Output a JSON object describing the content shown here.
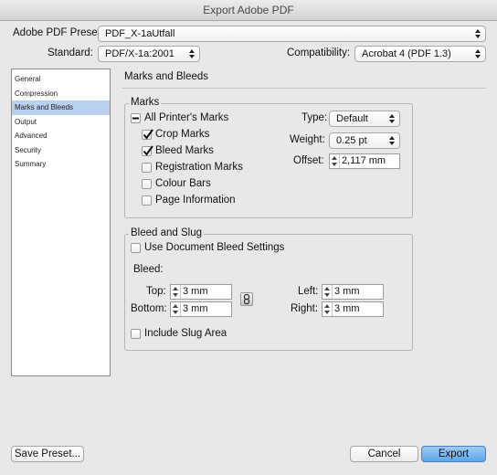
{
  "window": {
    "title": "Export Adobe PDF"
  },
  "header": {
    "preset_label": "Adobe PDF Preset:",
    "preset_value": "PDF_X-1aUtfall",
    "standard_label": "Standard:",
    "standard_value": "PDF/X-1a:2001",
    "compatibility_label": "Compatibility:",
    "compatibility_value": "Acrobat 4 (PDF 1.3)"
  },
  "sidebar": {
    "items": [
      {
        "label": "General"
      },
      {
        "label": "Compression"
      },
      {
        "label": "Marks and Bleeds"
      },
      {
        "label": "Output"
      },
      {
        "label": "Advanced"
      },
      {
        "label": "Security"
      },
      {
        "label": "Summary"
      }
    ],
    "selected": "Marks and Bleeds"
  },
  "main": {
    "section_title": "Marks and Bleeds",
    "marks": {
      "legend": "Marks",
      "all_printers_marks": {
        "label": "All Printer's Marks",
        "state": "mixed"
      },
      "crop_marks": {
        "label": "Crop Marks",
        "checked": true
      },
      "bleed_marks": {
        "label": "Bleed Marks",
        "checked": true
      },
      "registration_marks": {
        "label": "Registration Marks",
        "checked": false
      },
      "colour_bars": {
        "label": "Colour Bars",
        "checked": false
      },
      "page_information": {
        "label": "Page Information",
        "checked": false
      },
      "type_label": "Type:",
      "type_value": "Default",
      "weight_label": "Weight:",
      "weight_value": "0.25 pt",
      "offset_label": "Offset:",
      "offset_value": "2,117 mm"
    },
    "bleed_slug": {
      "legend": "Bleed and Slug",
      "use_document_bleed": {
        "label": "Use Document Bleed Settings",
        "checked": false
      },
      "bleed_label": "Bleed:",
      "top_label": "Top:",
      "top_value": "3 mm",
      "bottom_label": "Bottom:",
      "bottom_value": "3 mm",
      "left_label": "Left:",
      "left_value": "3 mm",
      "right_label": "Right:",
      "right_value": "3 mm",
      "include_slug": {
        "label": "Include Slug Area",
        "checked": false
      }
    }
  },
  "footer": {
    "save_preset": "Save Preset...",
    "cancel": "Cancel",
    "export": "Export"
  }
}
